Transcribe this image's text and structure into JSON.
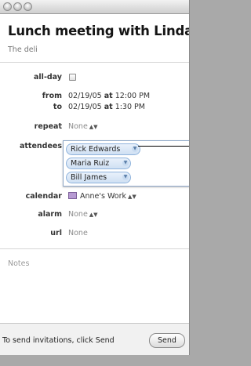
{
  "window": {
    "controls": [
      "close-button",
      "minimize-button",
      "zoom-button"
    ]
  },
  "event": {
    "title": "Lunch meeting with Linda",
    "location": "The deli"
  },
  "fields": {
    "allday_label": "all-day",
    "from_label": "from",
    "from_date": "02/19/05",
    "from_at": "at",
    "from_time": "12:00 PM",
    "to_label": "to",
    "to_date": "02/19/05",
    "to_at": "at",
    "to_time": "1:30 PM",
    "repeat_label": "repeat",
    "repeat_value": "None",
    "attendees_label": "attendees",
    "attendees": [
      "Rick Edwards",
      "Maria Ruiz",
      "Bill James"
    ],
    "calendar_label": "calendar",
    "calendar_value": "Anne's Work",
    "calendar_color": "#b79bd3",
    "alarm_label": "alarm",
    "alarm_value": "None",
    "url_label": "url",
    "url_value": "None"
  },
  "notes": {
    "placeholder": "Notes"
  },
  "footer": {
    "message": "To send invitations, click Send",
    "send_label": "Send"
  },
  "icons": {
    "stepper": "up-down-chevron-icon",
    "token_menu": "chevron-down-icon",
    "checkbox": "checkbox-unchecked-icon"
  }
}
